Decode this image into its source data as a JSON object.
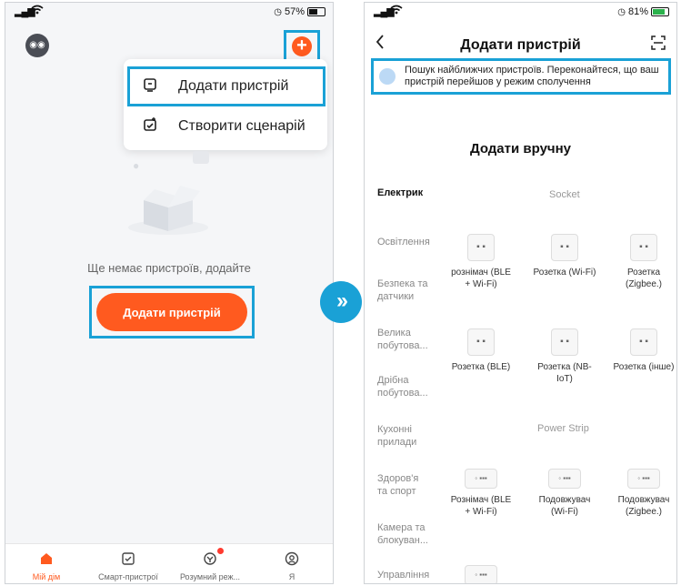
{
  "left": {
    "status": {
      "signal": "▂▄▆",
      "battery": "57%",
      "battery_level": 0.57
    },
    "menu": {
      "add_device": "Додати пристрій",
      "create_scenario": "Створити сценарій"
    },
    "empty_text": "Ще немає пристроїв, додайте",
    "add_button": "Додати пристрій",
    "tabs": [
      {
        "label": "Мій дім",
        "icon": "home-icon"
      },
      {
        "label": "Смарт-пристрої",
        "icon": "checkbox-icon"
      },
      {
        "label": "Розумний реж...",
        "icon": "scene-icon"
      },
      {
        "label": "Я",
        "icon": "profile-icon"
      }
    ]
  },
  "right": {
    "status": {
      "battery": "81%",
      "battery_level": 0.81
    },
    "title": "Додати пристрій",
    "search_banner": "Пошук найближчих пристроїв. Переконайтеся, що ваш пристрій перейшов у режим сполучення",
    "manual_title": "Додати вручну",
    "categories": [
      "Електрик",
      "Освітлення",
      "Безпека та датчики",
      "Велика побутова...",
      "Дрібна побутова...",
      "Кухонні прилади",
      "Здоров'я та спорт",
      "Камера та блокуван...",
      "Управління"
    ],
    "sections": {
      "socket": "Socket",
      "power_strip": "Power Strip"
    },
    "socket_devices": [
      "рознімач (BLE + Wi-Fi)",
      "Розетка (Wi-Fi)",
      "Розетка (Zigbee.)",
      "Розетка (BLE)",
      "Розетка (NB-IoT)",
      "Розетка (інше)"
    ],
    "strip_devices": [
      "Рознімач (BLE + Wi-Fi)",
      "Подовжувач (Wi-Fi)",
      "Подовжувач (Zigbee.)"
    ]
  },
  "colors": {
    "accent": "#ff5a1f",
    "highlight": "#1aa1d6"
  }
}
